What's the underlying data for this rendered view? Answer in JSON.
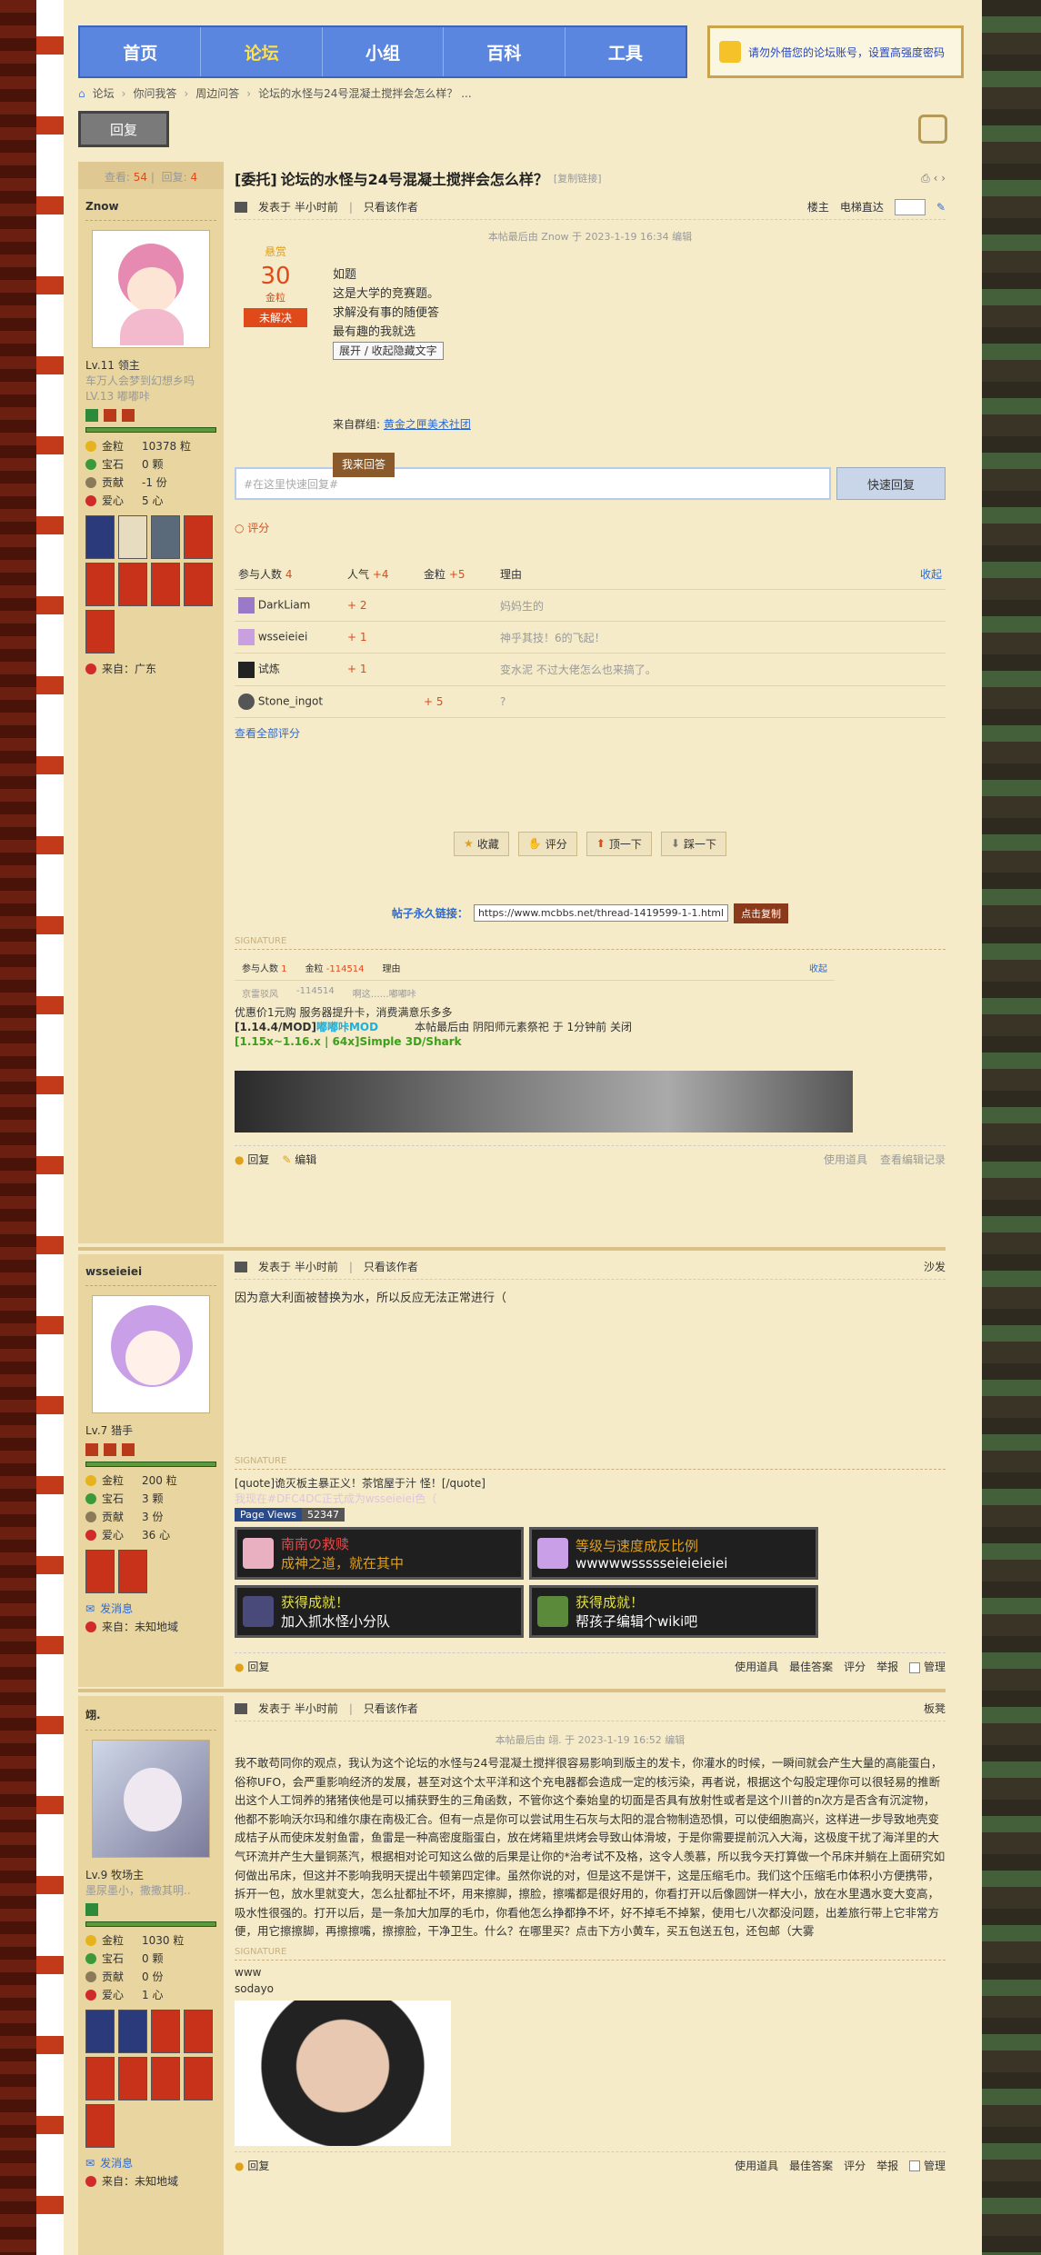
{
  "nav": {
    "items": [
      "首页",
      "论坛",
      "小组",
      "百科",
      "工具"
    ],
    "active": 1
  },
  "notice": "请勿外借您的论坛账号，设置高强度密码",
  "breadcrumb": [
    "论坛",
    "你问我答",
    "周边问答",
    "论坛的水怪与24号混凝土搅拌会怎么样？ ..."
  ],
  "reply_label": "回复",
  "thread": {
    "tag": "[委托]",
    "title": "论坛的水怪与24号混凝土搅拌会怎么样？",
    "copy_link": "[复制链接]"
  },
  "stats": {
    "views_label": "查看:",
    "views": "54",
    "replies_label": "回复:",
    "replies": "4"
  },
  "posts": [
    {
      "name": "Znow",
      "lv": "Lv.11 领主",
      "sub1": "车万人会梦到幻想乡吗",
      "sub2": "LV.13 嘟嘟咔",
      "gold": "金粒",
      "gold_v": "10378 粒",
      "gem": "宝石",
      "gem_v": "0 颗",
      "contrib": "贡献",
      "contrib_v": "-1 份",
      "love": "爱心",
      "love_v": "5 心",
      "from": "来自：广东",
      "posted": "发表于 半小时前",
      "only": "只看该作者",
      "floor": "楼主",
      "tele": "电梯直达",
      "edited": "本帖最后由 Znow 于 2023-1-19 16:34 编辑",
      "bounty": {
        "label": "悬赏",
        "amount": "30",
        "unit": "金粒",
        "status": "未解决"
      },
      "body": [
        "如题",
        "这是大学的竞赛题。",
        "求解没有事的随便答",
        "最有趣的我就选"
      ],
      "toggle": "展开 / 收起隐藏文字",
      "group_label": "来自群组:",
      "group": "黄金之匣美术社团",
      "answer_btn": "我来回答",
      "quick_ph": "#在这里快速回复#",
      "quick_btn": "快速回复",
      "rate_label": "评分",
      "rate_head": [
        "参与人数",
        "4",
        "人气",
        "+4",
        "金粒",
        "+5",
        "理由",
        "收起"
      ],
      "rates": [
        {
          "user": "DarkLiam",
          "pop": "+ 2",
          "gold": "",
          "reason": "妈妈生的"
        },
        {
          "user": "wsseieiei",
          "pop": "+ 1",
          "gold": "",
          "reason": "神乎其技！6的飞起！"
        },
        {
          "user": "试炼",
          "pop": "+ 1",
          "gold": "",
          "reason": "变水泥 不过大佬怎么也来搞了。"
        },
        {
          "user": "Stone_ingot",
          "pop": "",
          "gold": "+ 5",
          "reason": "?"
        }
      ],
      "all_rates": "查看全部评分",
      "actions": [
        "收藏",
        "评分",
        "顶一下",
        "踩一下"
      ],
      "perm_label": "帖子永久链接：",
      "perm": "https://www.mcbbs.net/thread-1419599-1-1.html",
      "copy": "点击复制",
      "sig_label": "SIGNATURE",
      "sig_tbl": [
        "参与人数",
        "1",
        "金粒",
        "-114514",
        "理由",
        "收起"
      ],
      "sig_row": [
        "京雷驳风",
        "-114514",
        "啊这……嘟嘟咔"
      ],
      "sig1": "优惠价1元购 服务器提升卡，消费满意乐多多",
      "sig2": "[1.14.4/MOD]嘟嘟咔MOD",
      "sig3": "[1.15x~1.16.x | 64x]Simple 3D/Shark",
      "sig_edit": "本帖最后由 阴阳师元素祭祀 于 1分钟前 关闭",
      "foot": [
        "回复",
        "编辑",
        "使用道具",
        "查看编辑记录"
      ]
    },
    {
      "name": "wsseieiei",
      "lv": "Lv.7 猎手",
      "gold": "金粒",
      "gold_v": "200 粒",
      "gem": "宝石",
      "gem_v": "3 颗",
      "contrib": "贡献",
      "contrib_v": "3 份",
      "love": "爱心",
      "love_v": "36 心",
      "msg": "发消息",
      "from": "来自：未知地域",
      "posted": "发表于 半小时前",
      "only": "只看该作者",
      "floor": "沙发",
      "body": "因为意大利面被替换为水，所以反应无法正常进行（",
      "sig_label": "SIGNATURE",
      "sig1": "[quote]诡灭板主暴正义！茶馆屋于汁 怪！[/quote]",
      "sig2": "我现在#DFC4DC正式成为wsseieiei色（",
      "pv_label": "Page Views",
      "pv": "52347",
      "ach": [
        {
          "t": "南南の救赎",
          "s": "成神之道，就在其中"
        },
        {
          "t": "等级与速度成反比例",
          "s": "wwwwwssssseieieieiei"
        },
        {
          "t": "获得成就！",
          "s": "加入抓水怪小分队"
        },
        {
          "t": "获得成就！",
          "s": "帮孩子编辑个wiki吧"
        }
      ],
      "foot": [
        "回复",
        "使用道具",
        "最佳答案",
        "评分",
        "举报",
        "管理"
      ]
    },
    {
      "name": "翊.",
      "lv": "Lv.9 牧场主",
      "sub1": "墨尿墨小，撒撒其明..",
      "gold": "金粒",
      "gold_v": "1030 粒",
      "gem": "宝石",
      "gem_v": "0 颗",
      "contrib": "贡献",
      "contrib_v": "0 份",
      "love": "爱心",
      "love_v": "1 心",
      "msg": "发消息",
      "from": "来自：未知地域",
      "posted": "发表于 半小时前",
      "only": "只看该作者",
      "floor": "板凳",
      "edited": "本帖最后由 翊. 于 2023-1-19 16:52 编辑",
      "body": "我不敢苟同你的观点，我认为这个论坛的水怪与24号混凝土搅拌很容易影响到版主的发卡，你灌水的时候，一瞬间就会产生大量的高能蛋白，俗称UFO，会严重影响经济的发展，甚至对这个太平洋和这个充电器都会造成一定的核污染，再者说，根据这个勾股定理你可以很轻易的推断出这个人工饲养的猪猪侠他是可以捕获野生的三角函数，不管你这个秦始皇的切面是否具有放射性或者是这个川普的n次方是否含有沉淀物，他都不影响沃尔玛和维尔康在南极汇合。但有一点是你可以尝试用生石灰与太阳的混合物制造恐惧，可以使细胞高兴，这样进一步导致地壳变成桔子从而使床发射鱼雷，鱼雷是一种高密度脂蛋白，放在烤箱里烘烤会导致山体滑坡，于是你需要提前沉入大海，这极度干扰了海洋里的大气环流并产生大量铜蒸汽，根据相对论可知这么做的后果是让你的*治考试不及格，这令人羡慕，所以我今天打算做一个吊床并躺在上面研究如何做出吊床，但这并不影响我明天提出牛顿第四定律。虽然你说的对，但是这不是饼干，这是压缩毛巾。我们这个压缩毛巾体积小方便携带，拆开一包，放水里就变大，怎么扯都扯不坏，用来擦脚，擦脸，擦嘴都是很好用的，你看打开以后像圆饼一样大小，放在水里遇水变大变高，吸水性很强的。打开以后，是一条加大加厚的毛巾，你看他怎么挣都挣不坏，好不掉毛不掉絮，使用七八次都没问题，出差旅行带上它非常方便，用它擦擦脚，再擦擦嘴，擦擦脸，干净卫生。什么？在哪里买？点击下方小黄车，买五包送五包，还包邮（大雾",
      "sig_label": "SIGNATURE",
      "sig1": "www",
      "sig2": "sodayo",
      "foot": [
        "回复",
        "使用道具",
        "最佳答案",
        "评分",
        "举报",
        "管理"
      ]
    }
  ]
}
